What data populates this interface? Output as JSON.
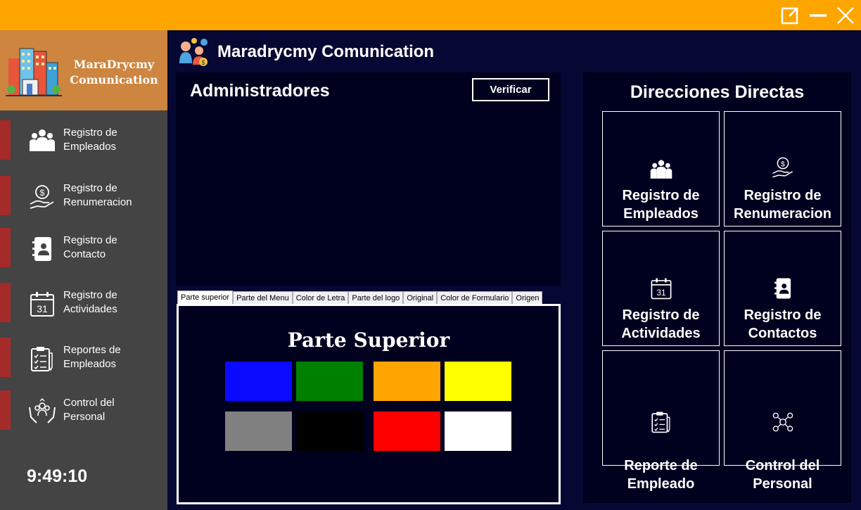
{
  "window": {
    "title_bar_color": "#FFA500",
    "buttons": [
      "maximize-icon",
      "minimize-icon",
      "close-icon"
    ]
  },
  "sidebar": {
    "logo_text": "MaraDrycmy\nComunication",
    "items": [
      {
        "label": "Registro de\nEmpleados",
        "icon": "users-icon"
      },
      {
        "label": "Registro de\nRenumeracion",
        "icon": "money-hand-icon"
      },
      {
        "label": "Registro de\nContacto",
        "icon": "contact-book-icon"
      },
      {
        "label": "Registro de\nActividades",
        "icon": "calendar-icon"
      },
      {
        "label": "Reportes de\nEmpleados",
        "icon": "clipboard-report-icon"
      },
      {
        "label": "Control del\nPersonal",
        "icon": "people-hands-icon"
      }
    ],
    "clock": "9:49:10"
  },
  "header": {
    "title": "Maradrycmy Comunication"
  },
  "admin": {
    "title": "Administradores",
    "verify_label": "Verificar"
  },
  "settings": {
    "tabs": [
      "Parte superior",
      "Parte del Menu",
      "Color de Letra",
      "Parte del logo",
      "Original",
      "Color de Formulario",
      "Origen"
    ],
    "active_tab": "Parte superior",
    "panel_title": "Parte Superior",
    "colors": [
      "#0A0AFF",
      "#008000",
      "#FFA500",
      "#FFFF00",
      "#808080",
      "#000000",
      "#FF0000",
      "#FFFFFF"
    ]
  },
  "direct": {
    "title": "Direcciones Directas",
    "tiles": [
      {
        "label": "Registro de\nEmpleados",
        "icon": "users-icon"
      },
      {
        "label": "Registro de\nRenumeracion",
        "icon": "money-hand-icon"
      },
      {
        "label": "Registro de\nActividades",
        "icon": "calendar-icon"
      },
      {
        "label": "Registro de\nContactos",
        "icon": "contact-book-icon"
      },
      {
        "label": "Reporte de\nEmpleado",
        "icon": "clipboard-report-icon"
      },
      {
        "label": "Control del\nPersonal",
        "icon": "people-network-icon"
      }
    ]
  }
}
